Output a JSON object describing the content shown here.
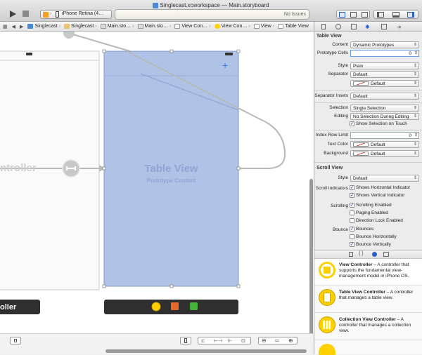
{
  "window": {
    "title": "Singlecast.xcworkspace — Main.storyboard"
  },
  "toolbar": {
    "scheme": "iPhone Retina (4…",
    "activity_status": "No Issues"
  },
  "jumpbar": {
    "crumbs": [
      "Singlecast",
      "Singlecast",
      "Main.sto…",
      "Main.sto…",
      "View Con…",
      "View Con…",
      "View",
      "Table View"
    ]
  },
  "canvas": {
    "left_scene_label": "ntroller",
    "left_scene_bar_label": "oller",
    "table_view_title": "Table View",
    "table_view_subtitle": "Prototype Content",
    "add_glyph": "+"
  },
  "inspector": {
    "table_view": {
      "heading": "Table View",
      "content_label": "Content",
      "content_value": "Dynamic Prototypes",
      "prototype_cells_label": "Prototype Cells",
      "prototype_cells_value": "0",
      "style_label": "Style",
      "style_value": "Plain",
      "separator_label": "Separator",
      "separator_value": "Default",
      "separator_color_value": "Default",
      "separator_insets_label": "Separator Insets",
      "separator_insets_value": "Default",
      "selection_label": "Selection",
      "selection_value": "Single Selection",
      "editing_label": "Editing",
      "editing_value": "No Selection During Editing",
      "show_selection_on_touch": "Show Selection on Touch",
      "index_row_limit_label": "Index Row Limit",
      "index_row_limit_value": "0",
      "text_color_label": "Text Color",
      "text_color_value": "Default",
      "background_label": "Background",
      "background_value": "Default"
    },
    "scroll_view": {
      "heading": "Scroll View",
      "style_label": "Style",
      "style_value": "Default",
      "scroll_indicators_label": "Scroll Indicators",
      "shows_horizontal": "Shows Horizontal Indicator",
      "shows_vertical": "Shows Vertical Indicator",
      "scrolling_label": "Scrolling",
      "scrolling_enabled": "Scrolling Enabled",
      "paging_enabled": "Paging Enabled",
      "direction_lock": "Direction Lock Enabled",
      "bounce_label": "Bounce",
      "bounces": "Bounces",
      "bounce_horizontally": "Bounce Horizontally",
      "bounce_vertically": "Bounce Vertically"
    }
  },
  "library": {
    "lib_tab_code": "{ }",
    "items": [
      {
        "title": "View Controller",
        "desc": " – A controller that supports the fundamental view-management model in iPhone OS."
      },
      {
        "title": "Table View Controller",
        "desc": " – A controller that manages a table view."
      },
      {
        "title": "Collection View Controller",
        "desc": " – A controller that manages a collection view."
      }
    ]
  },
  "colors": {
    "selection_blue": "#aec3e6",
    "accent": "#3478f6",
    "library_icon": "#ffd000"
  }
}
